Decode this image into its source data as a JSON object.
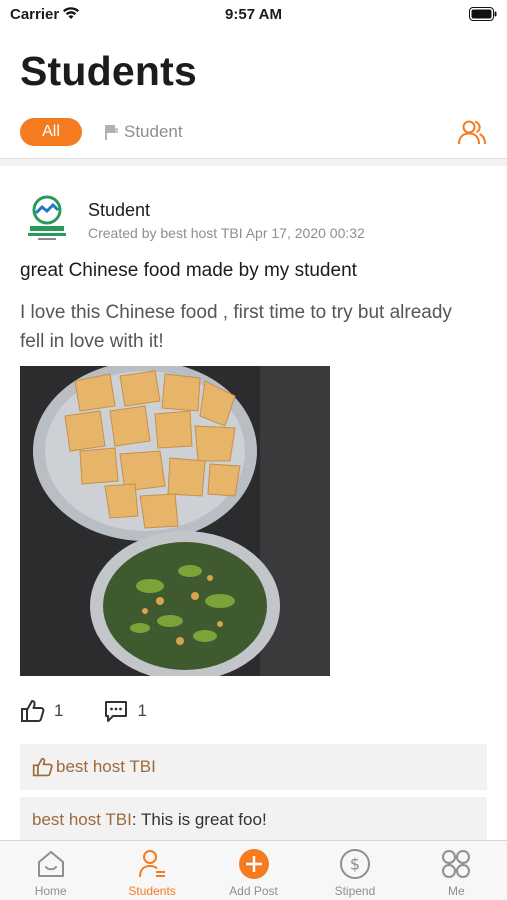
{
  "status_bar": {
    "carrier": "Carrier",
    "time": "9:57 AM"
  },
  "page_title": "Students",
  "filters": {
    "all_label": "All",
    "student_label": "Student"
  },
  "post": {
    "author": "Student",
    "meta": "Created by best host TBI Apr 17, 2020 00:32",
    "title": "great Chinese food made by my student",
    "body": "I love this Chinese food , first time to try but already fell in love with it!",
    "like_count": "1",
    "comment_count": "1",
    "likes_line": "best host TBI",
    "comment": {
      "author": "best host TBI",
      "text": ": This is great foo!"
    }
  },
  "tabs": [
    {
      "label": "Home",
      "icon": "home-icon"
    },
    {
      "label": "Students",
      "icon": "student-icon",
      "active": true
    },
    {
      "label": "Add Post",
      "icon": "add-icon"
    },
    {
      "label": "Stipend",
      "icon": "dollar-icon"
    },
    {
      "label": "Me",
      "icon": "grid-icon"
    }
  ],
  "colors": {
    "accent": "#f47b20",
    "like_text": "#9c6a3c",
    "muted": "#8e8e93"
  }
}
